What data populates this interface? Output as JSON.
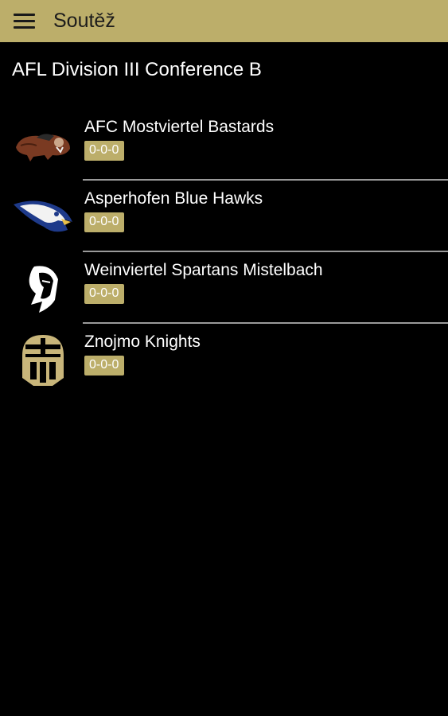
{
  "appbar": {
    "title": "Soutěž",
    "accent_color": "#bcae6a"
  },
  "section": {
    "title": "AFL Division III Conference B"
  },
  "teams": [
    {
      "name": "AFC Mostviertel Bastards",
      "record": "0-0-0",
      "logo": "boar-logo-icon"
    },
    {
      "name": "Asperhofen Blue Hawks",
      "record": "0-0-0",
      "logo": "hawk-logo-icon"
    },
    {
      "name": "Weinviertel Spartans Mistelbach",
      "record": "0-0-0",
      "logo": "spartan-logo-icon"
    },
    {
      "name": "Znojmo Knights",
      "record": "0-0-0",
      "logo": "knight-helmet-logo-icon"
    }
  ]
}
